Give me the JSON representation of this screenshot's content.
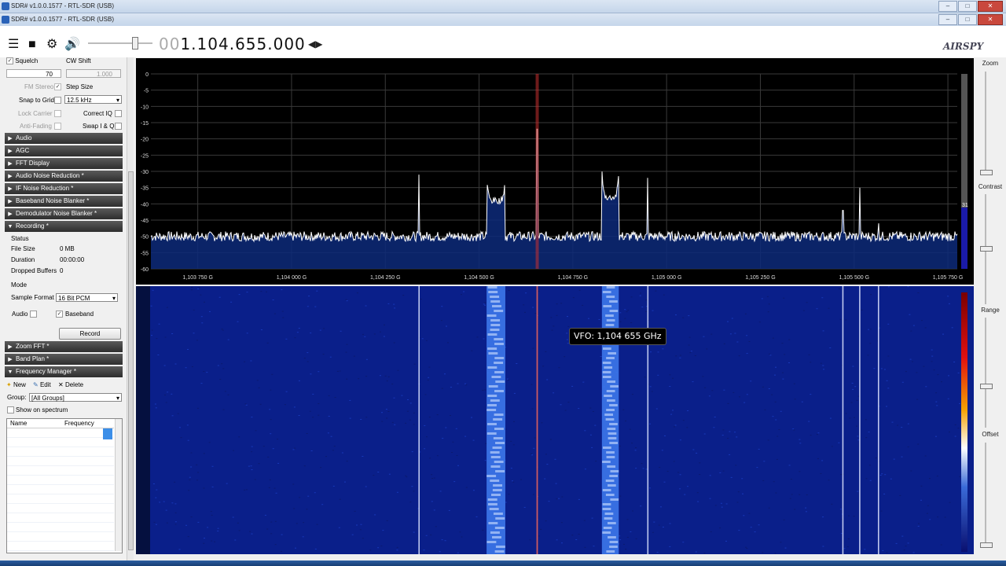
{
  "windows": [
    {
      "title": "SDR# v1.0.0.1577 - RTL-SDR (USB)"
    },
    {
      "title": "SDR# v1.0.0.1577 - RTL-SDR (USB)"
    }
  ],
  "toolbar": {
    "frequency_dim": "00",
    "frequency_main": "1.104.655.000",
    "logo": "AIRSPY"
  },
  "left": {
    "squelch_label": "Squelch",
    "squelch_value": "70",
    "cw_shift_label": "CW Shift",
    "cw_shift_value": "1.000",
    "fm_stereo_label": "FM Stereo",
    "step_size_label": "Step Size",
    "snap_to_grid_label": "Snap to Grid",
    "step_size_value": "12.5 kHz",
    "lock_carrier_label": "Lock Carrier",
    "correct_iq_label": "Correct IQ",
    "anti_fading_label": "Anti-Fading",
    "swap_iq_label": "Swap I & Q",
    "sections": [
      "Audio",
      "AGC",
      "FFT Display",
      "Audio Noise Reduction *",
      "IF Noise Reduction *",
      "Baseband Noise Blanker *",
      "Demodulator Noise Blanker *",
      "Recording *"
    ],
    "recording": {
      "status_label": "Status",
      "file_size_label": "File Size",
      "file_size_value": "0 MB",
      "duration_label": "Duration",
      "duration_value": "00:00:00",
      "dropped_label": "Dropped Buffers",
      "dropped_value": "0",
      "mode_label": "Mode",
      "sample_format_label": "Sample Format",
      "sample_format_value": "16 Bit PCM",
      "audio_label": "Audio",
      "baseband_label": "Baseband",
      "record_button": "Record"
    },
    "sections2": [
      "Zoom FFT *",
      "Band Plan *",
      "Frequency Manager *"
    ],
    "freq_manager": {
      "new_label": "New",
      "edit_label": "Edit",
      "delete_label": "Delete",
      "group_label": "Group:",
      "group_value": "[All Groups]",
      "show_on_spectrum_label": "Show on spectrum",
      "col_name": "Name",
      "col_frequency": "Frequency"
    }
  },
  "chart_data": {
    "type": "line",
    "title": "",
    "xlabel": "",
    "ylabel": "",
    "x_ticks": [
      "1,103 750 G",
      "1,104 000 G",
      "1,104 250 G",
      "1,104 500 G",
      "1,104 750 G",
      "1,105 000 G",
      "1,105 250 G",
      "1,105 500 G",
      "1,105 750 G"
    ],
    "y_ticks": [
      "0",
      "-5",
      "-10",
      "-15",
      "-20",
      "-25",
      "-30",
      "-35",
      "-40",
      "-45",
      "-50",
      "-55",
      "-60"
    ],
    "xlim_mhz": [
      1103.625,
      1105.775
    ],
    "ylim": [
      -60,
      0
    ],
    "noise_floor_db": -50,
    "grid": true,
    "vfo_mhz": 1104.655,
    "peaks": [
      {
        "x": 1104.34,
        "y": -31,
        "kind": "spike"
      },
      {
        "x": 1104.545,
        "y": -39,
        "kind": "band",
        "width": 0.05
      },
      {
        "x": 1104.655,
        "y": -17,
        "kind": "spike"
      },
      {
        "x": 1104.85,
        "y": -38,
        "kind": "band",
        "width": 0.045
      },
      {
        "x": 1104.95,
        "y": -32,
        "kind": "spike"
      },
      {
        "x": 1105.47,
        "y": -42,
        "kind": "spike"
      },
      {
        "x": 1105.515,
        "y": -35,
        "kind": "spike"
      },
      {
        "x": 1105.565,
        "y": -46,
        "kind": "spike"
      }
    ],
    "level_readout": "31"
  },
  "vfo_tooltip": "VFO: 1,104 655 GHz",
  "right_panel": {
    "zoom_label": "Zoom",
    "contrast_label": "Contrast",
    "range_label": "Range",
    "offset_label": "Offset"
  },
  "colors": {
    "spectrum_bg": "#000000",
    "trace": "#ffffff",
    "fill": "#0d2a7a",
    "vfo_line": "#c83030",
    "waterfall_bg": "#0a1f8a"
  }
}
